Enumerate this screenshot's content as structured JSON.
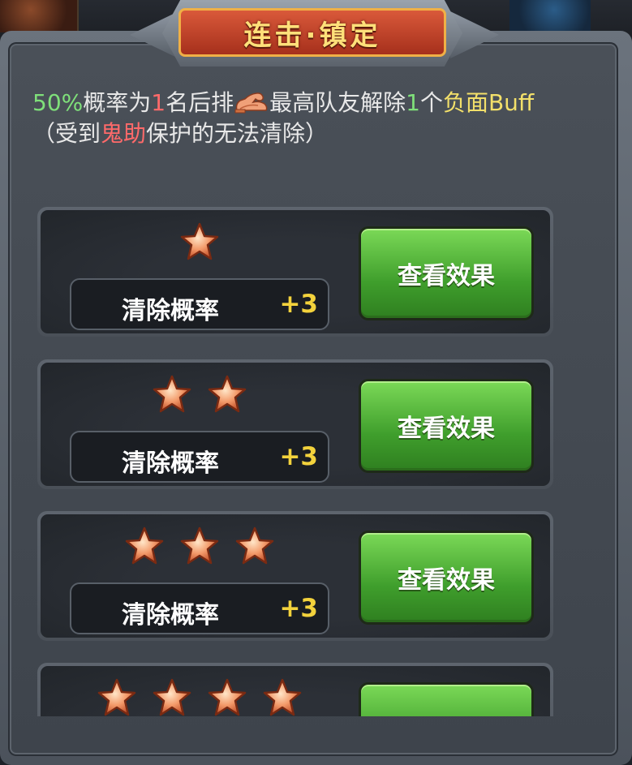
{
  "dialog": {
    "title": "连击·镇定",
    "description": {
      "chance": "50%",
      "t1": "概率为",
      "count": "1",
      "t2": "名后排",
      "t3": "最高队友解除",
      "remove_count": "1",
      "t4": "个",
      "debuff": "负面Buff",
      "t5": "（受到",
      "ghost_help": "鬼助",
      "t6": "保护的无法清除",
      "t7": "）",
      "stat_icon": "muscle-icon"
    }
  },
  "levels": [
    {
      "stars": 1,
      "stat_label": "清除概率",
      "stat_value": "+3",
      "button_label": "查看效果"
    },
    {
      "stars": 2,
      "stat_label": "清除概率",
      "stat_value": "+3",
      "button_label": "查看效果"
    },
    {
      "stars": 3,
      "stat_label": "清除概率",
      "stat_value": "+3",
      "button_label": "查看效果"
    },
    {
      "stars": 4,
      "stat_label": "",
      "stat_value": "",
      "button_label": ""
    }
  ],
  "colors": {
    "highlight_green": "#7fe07a",
    "highlight_red": "#ff6a6a",
    "highlight_yellow": "#f3e06a",
    "stat_value": "#f3d23c",
    "button_green": "#4caf35",
    "title_plate": "#c2442a"
  }
}
